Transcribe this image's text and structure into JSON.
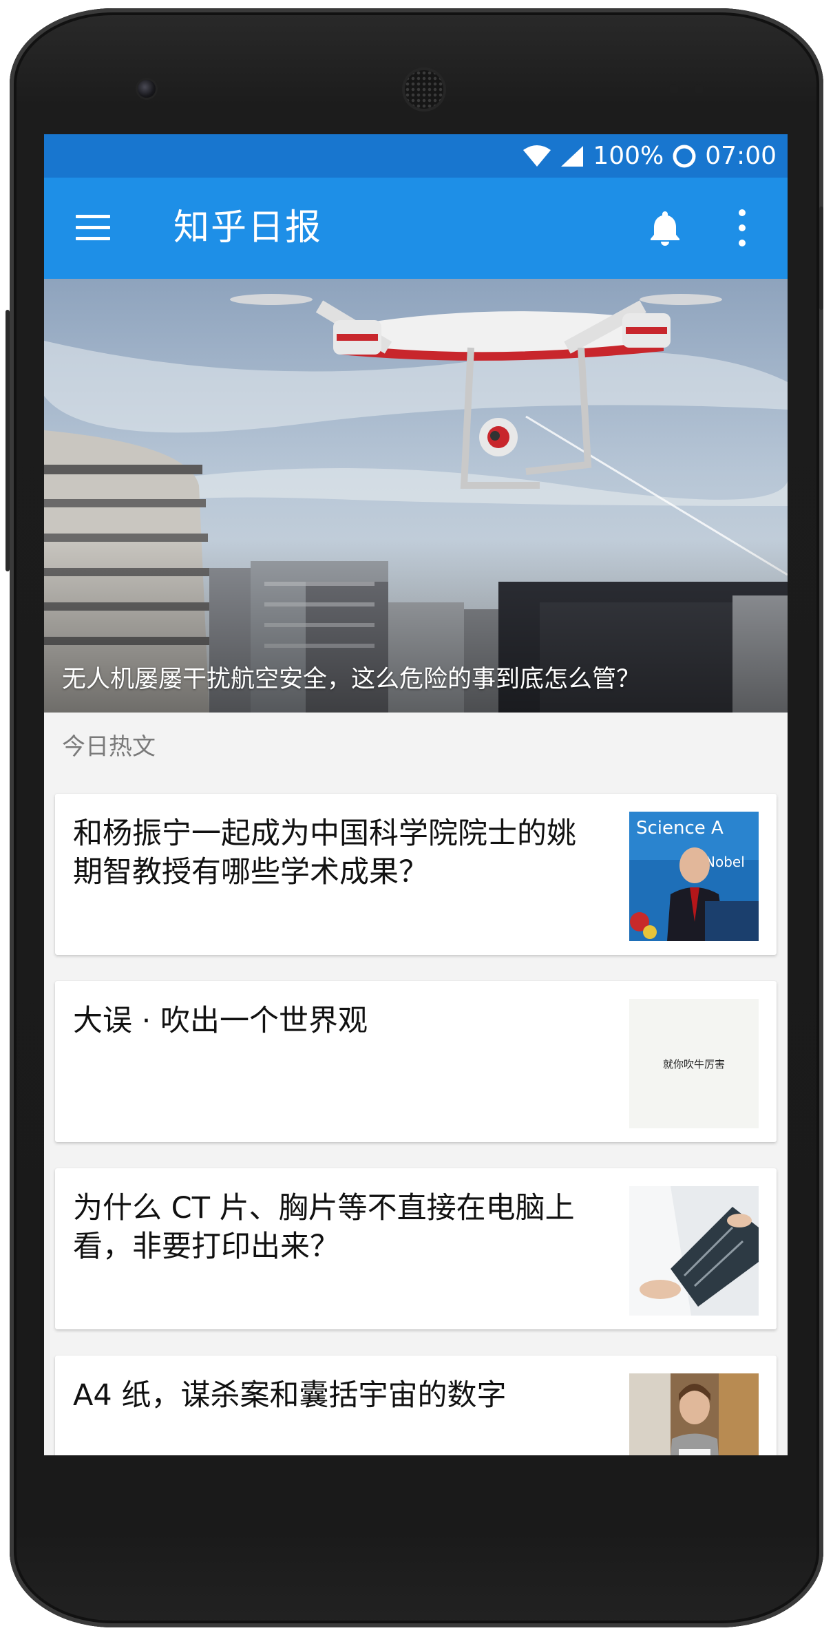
{
  "status_bar": {
    "battery": "100%",
    "time": "07:00"
  },
  "app_bar": {
    "title": "知乎日报",
    "menu_icon": "hamburger-menu-icon",
    "notification_icon": "bell-icon",
    "overflow_icon": "more-vert-icon"
  },
  "hero": {
    "caption": "无人机屡屡干扰航空安全，这么危险的事到底怎么管？"
  },
  "section": {
    "label": "今日热文"
  },
  "stories": [
    {
      "title": "和杨振宁一起成为中国科学院院士的姚期智教授有哪些学术成果？",
      "thumb": "speaker-photo"
    },
    {
      "title": "大误 · 吹出一个世界观",
      "thumb_text": "就你吹牛厉害"
    },
    {
      "title": "为什么 CT 片、胸片等不直接在电脑上看，非要打印出来？",
      "thumb": "xray-photo"
    },
    {
      "title": "A4 纸，谋杀案和囊括宇宙的数字",
      "thumb": "person-photo"
    }
  ],
  "colors": {
    "status_bar": "#1876cf",
    "app_bar": "#1e8fe7",
    "background": "#f3f3f3",
    "card": "#ffffff"
  }
}
